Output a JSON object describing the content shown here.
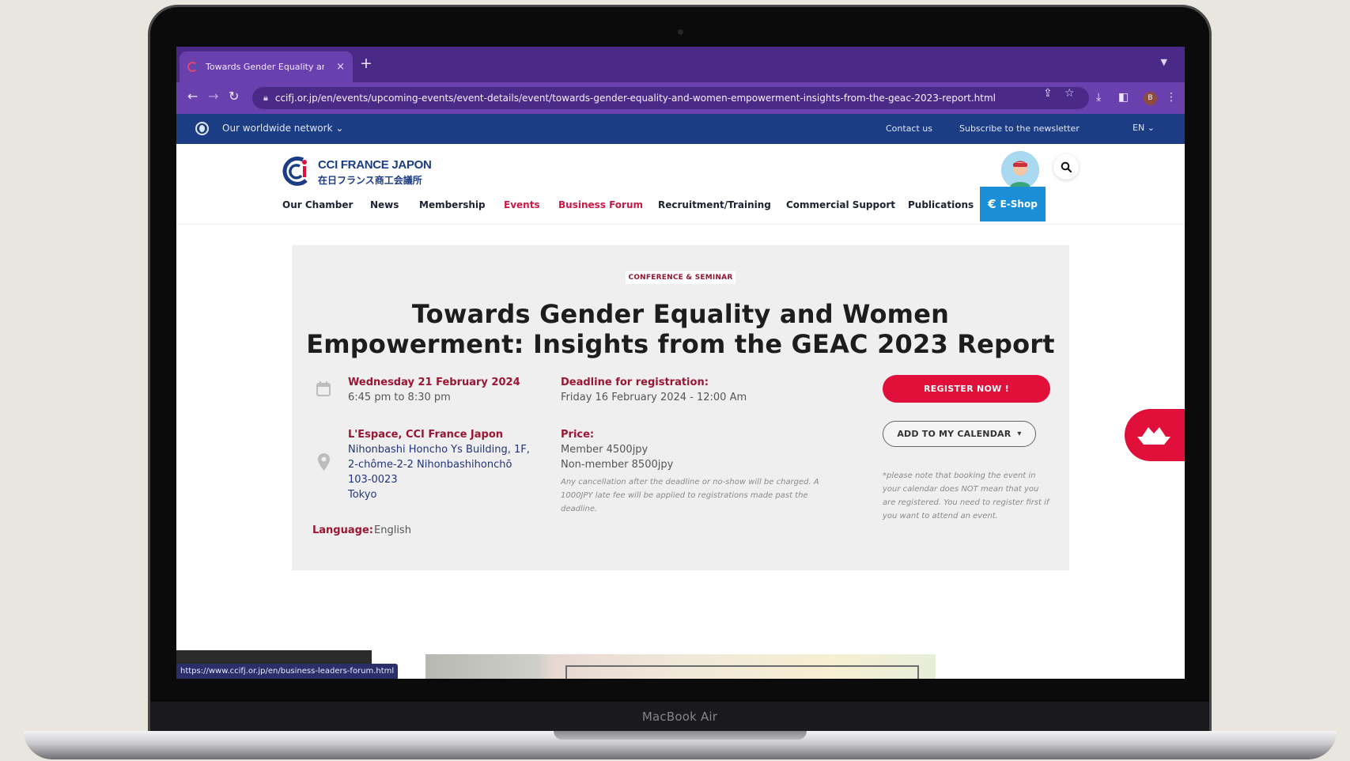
{
  "device": {
    "label": "MacBook Air"
  },
  "browser": {
    "tab_title": "Towards Gender Equality and",
    "tab_close": "×",
    "new_tab": "+",
    "url": "ccifj.or.jp/en/events/upcoming-events/event-details/event/towards-gender-equality-and-women-empowerment-insights-from-the-geac-2023-report.html",
    "profile_initial": "B",
    "status_url": "https://www.ccifj.or.jp/en/business-leaders-forum.html"
  },
  "topbar": {
    "network": "Our worldwide network",
    "contact": "Contact us",
    "subscribe": "Subscribe to the newsletter",
    "language": "EN"
  },
  "logo": {
    "line1": "CCI FRANCE JAPON",
    "line2": "在日フランス商工会議所"
  },
  "nav": {
    "items": [
      "Our Chamber",
      "News",
      "Membership",
      "Events",
      "Business Forum",
      "Recruitment/Training",
      "Commercial Support",
      "Publications"
    ],
    "eshop": "E-Shop"
  },
  "event": {
    "category": "CONFERENCE & SEMINAR",
    "title_line1": "Towards Gender Equality and Women",
    "title_line2": "Empowerment: Insights from the GEAC 2023 Report",
    "date": "Wednesday 21 February 2024",
    "time": "6:45 pm to 8:30 pm",
    "venue": "L'Espace, CCI France Japon",
    "address": [
      "Nihonbashi Honcho Ys Building, 1F,",
      "2-chôme-2-2 Nihonbashihonchō",
      "103-0023",
      "Tokyo"
    ],
    "language_label": "Language:",
    "language_value": "English",
    "deadline_label": "Deadline for registration:",
    "deadline_value": "Friday 16 February 2024 - 12:00 Am",
    "price_label": "Price:",
    "price_member": "Member 4500jpy",
    "price_nonmember": "Non-member 8500jpy",
    "price_note": "Any cancellation after the deadline or no-show will be charged. A 1000JPY late fee will be applied to registrations made past the deadline.",
    "register_button": "REGISTER NOW !",
    "calendar_button": "ADD TO MY CALENDAR",
    "calendar_note": "*please note that booking the event in your calendar does NOT mean that you are registered. You need to register first if you want to attend an event."
  },
  "colors": {
    "brand_blue": "#1c3c83",
    "accent_red": "#e0103b",
    "dark_red": "#9a1633",
    "eshop_blue": "#1a8fd8",
    "browser_purple": "#6a3fae"
  }
}
